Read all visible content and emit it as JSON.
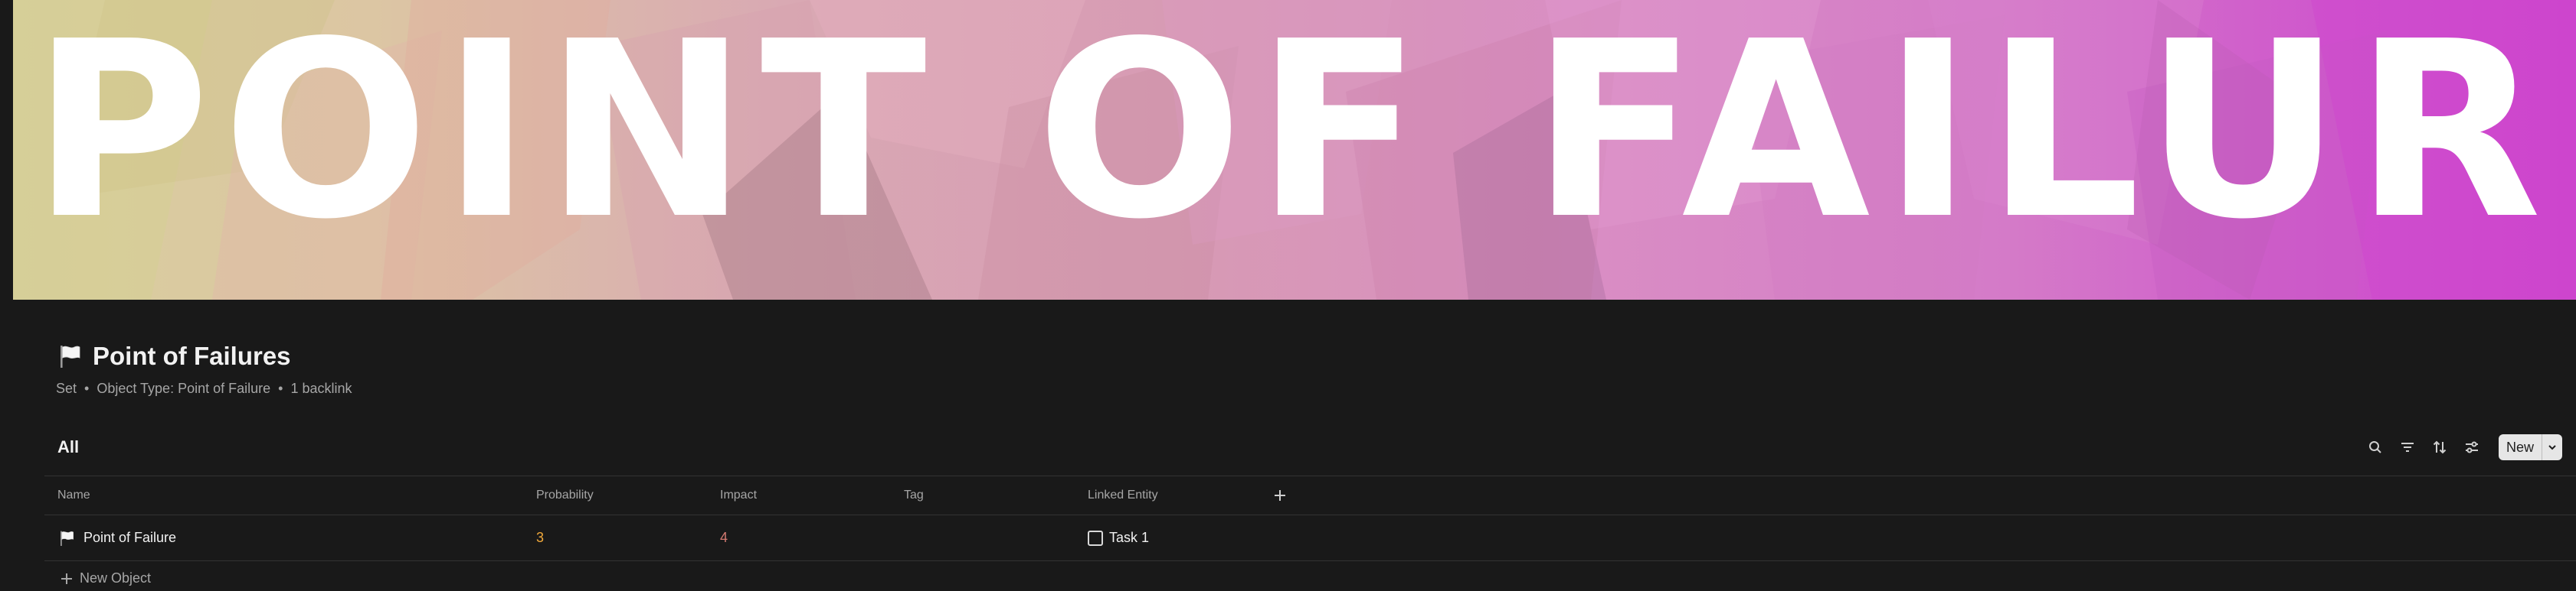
{
  "cover": {
    "text": "POINT OF FAILURES"
  },
  "header": {
    "title": "Point of Failures",
    "icon": "white-flag-icon",
    "meta": {
      "layout": "Set",
      "object_type": "Object Type: Point of Failure",
      "backlinks": "1 backlink"
    }
  },
  "view": {
    "active_tab": "All"
  },
  "toolbar": {
    "icons": [
      "search-icon",
      "filter-icon",
      "sort-icon",
      "settings-icon"
    ],
    "new_label": "New"
  },
  "table": {
    "columns": [
      "Name",
      "Probability",
      "Impact",
      "Tag",
      "Linked Entity"
    ],
    "rows": [
      {
        "name": "Point of Failure",
        "probability": "3",
        "impact": "4",
        "tag": "",
        "linked_entity": "Task 1"
      }
    ],
    "new_object_label": "New Object"
  },
  "colors": {
    "background": "#191919",
    "probability": "#f0a83a",
    "impact": "#d47b72"
  }
}
